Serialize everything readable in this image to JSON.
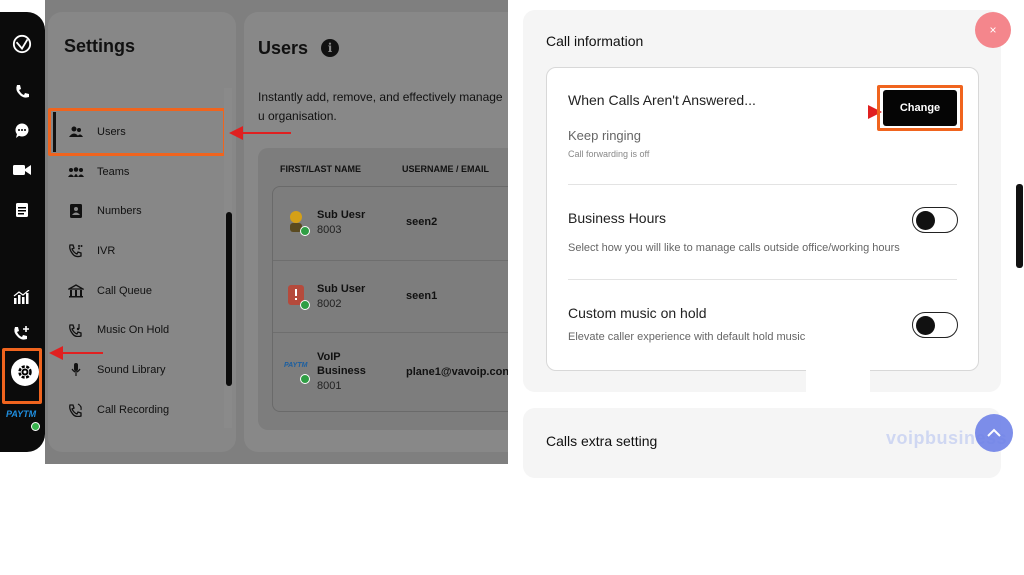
{
  "settings": {
    "title": "Settings",
    "items": [
      {
        "label": "Users",
        "icon": "user-icon"
      },
      {
        "label": "Teams",
        "icon": "team-icon"
      },
      {
        "label": "Numbers",
        "icon": "contact-card-icon"
      },
      {
        "label": "IVR",
        "icon": "phone-keypad-icon"
      },
      {
        "label": "Call Queue",
        "icon": "queue-icon"
      },
      {
        "label": "Music On Hold",
        "icon": "music-phone-icon"
      },
      {
        "label": "Sound Library",
        "icon": "microphone-icon"
      },
      {
        "label": "Call Recording",
        "icon": "recording-phone-icon"
      }
    ]
  },
  "rail": {
    "icons": [
      "logo-icon",
      "phone-icon",
      "chat-icon",
      "video-icon",
      "notes-icon",
      "analytics-icon",
      "add-call-icon",
      "gear-icon"
    ],
    "brand": "PAYTM"
  },
  "users": {
    "title": "Users",
    "description": "Instantly add, remove, and effectively manage u organisation.",
    "columns": [
      "FIRST/LAST NAME",
      "USERNAME / EMAIL"
    ],
    "rows": [
      {
        "name": "Sub Uesr",
        "ext": "8003",
        "email": "seen2"
      },
      {
        "name": "Sub User",
        "ext": "8002",
        "email": "seen1"
      },
      {
        "name": "VoIP Business",
        "ext": "8001",
        "email": "plane1@vavoip.con"
      }
    ],
    "row3_brand": "PAYTM"
  },
  "call_info": {
    "title": "Call information",
    "unanswered_label": "When Calls Aren't Answered...",
    "change_label": "Change",
    "keep_ringing": "Keep ringing",
    "forwarding_status": "Call forwarding is off",
    "business_hours_label": "Business Hours",
    "business_hours_desc": "Select how you will like to manage calls outside office/working hours",
    "music_label": "Custom music on hold",
    "music_desc": "Elevate caller experience with default hold music"
  },
  "extra": {
    "title": "Calls extra setting"
  },
  "close_label": "×",
  "watermark": "voipbusiness",
  "colors": {
    "highlight": "#f0641e",
    "arrow": "#e02020",
    "accent": "#6f82e8",
    "close": "#f4868c"
  }
}
